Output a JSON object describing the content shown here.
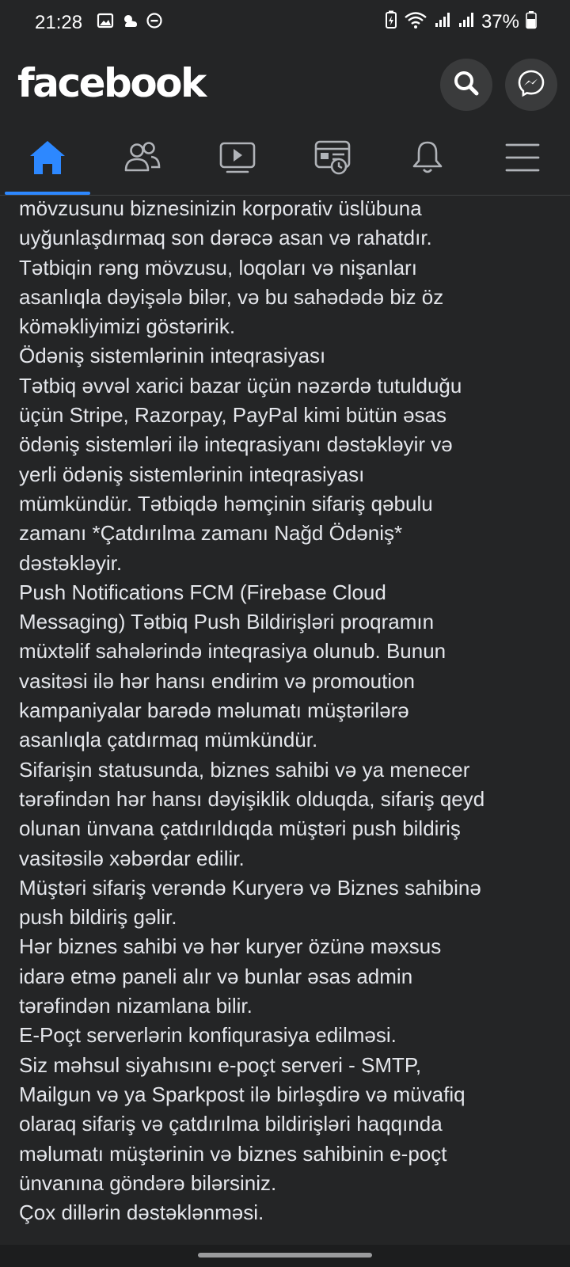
{
  "status_bar": {
    "time": "21:28",
    "battery_percent": "37%",
    "icons": [
      "gallery-icon",
      "weather-icon",
      "do-not-disturb-icon",
      "battery-saver-icon",
      "wifi-icon",
      "signal-icon",
      "signal-icon",
      "battery-icon"
    ]
  },
  "header": {
    "logo": "facebook",
    "search_icon": "search-icon",
    "messenger_icon": "messenger-icon"
  },
  "nav": {
    "tabs": [
      {
        "name": "home",
        "icon": "home-icon",
        "active": true
      },
      {
        "name": "friends",
        "icon": "friends-icon",
        "active": false
      },
      {
        "name": "watch",
        "icon": "video-icon",
        "active": false
      },
      {
        "name": "marketplace",
        "icon": "news-icon",
        "active": false
      },
      {
        "name": "notifications",
        "icon": "bell-icon",
        "active": false
      },
      {
        "name": "menu",
        "icon": "hamburger-icon",
        "active": false
      }
    ],
    "accent_color": "#2d88ff"
  },
  "post": {
    "paragraphs": [
      "mövzusunu biznesinizin korporativ üslübuna\nuyğunlaşdırmaq son dərəcə asan və rahatdır.\nTətbiqin rəng mövzusu, loqoları və nişanları\nasanlıqla dəyişələ bilər, və bu sahədədə biz öz\nköməkliyimizi göstəririk.",
      "Ödəniş sistemlərinin inteqrasiyası",
      "Tətbiq əvvəl xarici bazar üçün nəzərdə tutulduğu\nüçün Stripe, Razorpay, PayPal kimi bütün əsas\nödəniş sistemləri ilə inteqrasiyanı dəstəkləyir və\nyerli ödəniş sistemlərinin inteqrasiyası\nmümkündür. Tətbiqdə həmçinin sifariş qəbulu\nzamanı *Çatdırılma zamanı Nağd Ödəniş*\ndəstəkləyir.",
      "Push Notifications FCM (Firebase Cloud\nMessaging) Tətbiq Push Bildirişləri proqramın\nmüxtəlif sahələrində inteqrasiya olunub. Bunun\nvasitəsi ilə hər hansı endirim və promoution\nkampaniyalar barədə məlumatı müştərilərə\nasanlıqla çatdırmaq mümkündür.",
      "Sifarişin  statusunda, biznes sahibi və ya menecer\ntərəfindən hər hansı dəyişiklik olduqda, sifariş qeyd\nolunan ünvana çatdırıldıqda müştəri push bildiriş\nvasitəsilə xəbərdar edilir.",
      "Müştəri sifariş verəndə Kuryerə və Biznes sahibinə\npush bildiriş gəlir.",
      "Hər biznes sahibi və hər kuryer özünə məxsus\nidarə etmə paneli alır və bunlar əsas admin\ntərəfindən nizamlana bilir.",
      "E-Poçt serverlərin konfiqurasiya edilməsi.",
      "Siz məhsul siyahısını e-poçt serveri - SMTP,\nMailgun və ya Sparkpost ilə birləşdirə və müvafiq\nolaraq sifariş və çatdırılma bildirişləri haqqında\nməlumatı müştərinin və biznes sahibinin e-poçt\nünvanına göndərə bilərsiniz.",
      "Çox dillərin dəstəklənməsi."
    ]
  }
}
